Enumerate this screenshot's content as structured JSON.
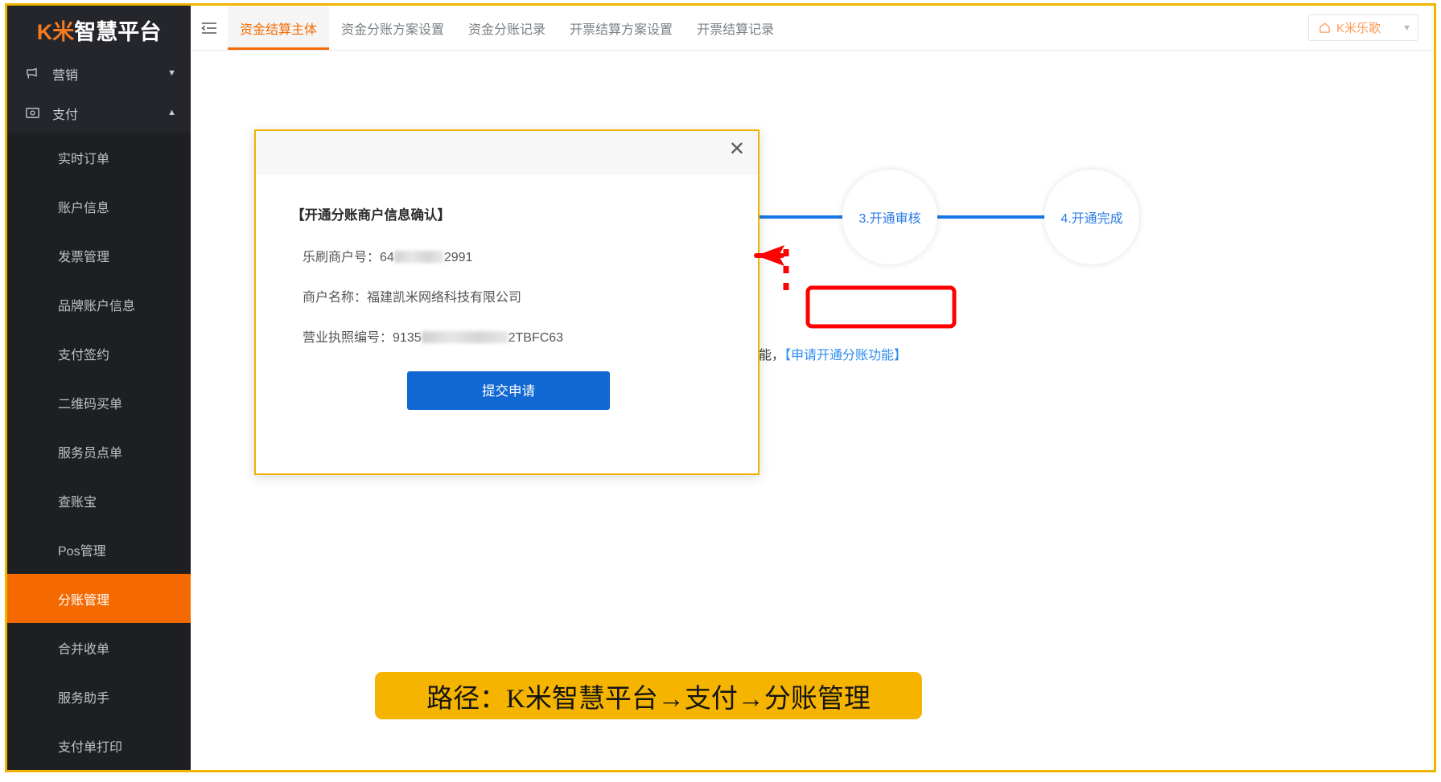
{
  "brand": {
    "highlight": "K米",
    "rest": "智慧平台"
  },
  "sidebar": {
    "groups": [
      {
        "label": "营销",
        "icon": "megaphone-icon",
        "caret": "▼",
        "expanded": false
      },
      {
        "label": "支付",
        "icon": "payment-icon",
        "caret": "▲",
        "expanded": true
      }
    ],
    "items": [
      {
        "label": "实时订单",
        "active": false
      },
      {
        "label": "账户信息",
        "active": false
      },
      {
        "label": "发票管理",
        "active": false
      },
      {
        "label": "品牌账户信息",
        "active": false
      },
      {
        "label": "支付签约",
        "active": false
      },
      {
        "label": "二维码买单",
        "active": false
      },
      {
        "label": "服务员点单",
        "active": false
      },
      {
        "label": "查账宝",
        "active": false
      },
      {
        "label": "Pos管理",
        "active": false
      },
      {
        "label": "分账管理",
        "active": true
      },
      {
        "label": "合并收单",
        "active": false
      },
      {
        "label": "服务助手",
        "active": false
      },
      {
        "label": "支付单打印",
        "active": false
      }
    ]
  },
  "topbar": {
    "collapse_icon": "collapse-menu-icon",
    "tabs": [
      {
        "label": "资金结算主体",
        "active": true
      },
      {
        "label": "资金分账方案设置",
        "active": false
      },
      {
        "label": "资金分账记录",
        "active": false
      },
      {
        "label": "开票结算方案设置",
        "active": false
      },
      {
        "label": "开票结算记录",
        "active": false
      }
    ],
    "user": {
      "name": "K米乐歌",
      "home_icon": "home-icon",
      "caret": "▼"
    }
  },
  "steps": [
    {
      "label": "3.开通审核"
    },
    {
      "label": "4.开通完成"
    }
  ],
  "hint": {
    "prefix": "分账功能，",
    "link": "【申请开通分账功能】"
  },
  "modal": {
    "close_label": "✕",
    "title": "【开通分账商户信息确认】",
    "rows": [
      {
        "label": "乐刷商户号：",
        "value_prefix": "64",
        "value_suffix": "2991",
        "redacted": true
      },
      {
        "label": "商户名称：",
        "value_prefix": "福建凯米网络科技有限公司",
        "value_suffix": "",
        "redacted": false
      },
      {
        "label": "营业执照编号：",
        "value_prefix": "9135",
        "value_suffix": "2TBFC63",
        "redacted": true
      }
    ],
    "submit_label": "提交申请"
  },
  "annotations": {
    "path_banner": "路径：K米智慧平台→支付→分账管理",
    "arrow": "left-arrow-annotation",
    "highlight_box": "red-highlight-box"
  },
  "colors": {
    "brand_orange": "#f47920",
    "active_orange": "#f56a00",
    "sidebar_bg": "#24262b",
    "submenu_bg": "#1d1f23",
    "step_blue": "#1877e6",
    "link_blue": "#2b8cf0",
    "button_blue": "#1268d3",
    "annotation_red": "#ff0000",
    "annotation_yellow": "#f5b400"
  }
}
